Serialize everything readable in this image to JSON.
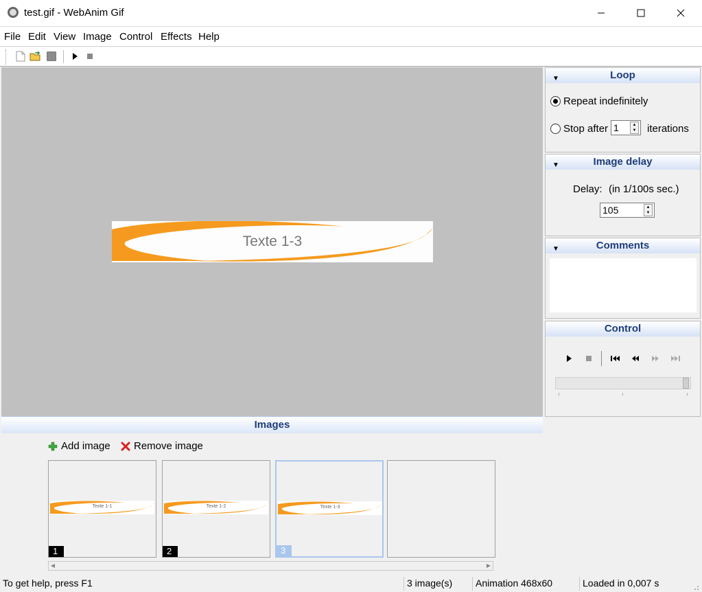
{
  "window": {
    "title": "test.gif - WebAnim Gif"
  },
  "menu": [
    "File",
    "Edit",
    "View",
    "Image",
    "Control",
    "Effects",
    "Help"
  ],
  "toolbar": {
    "icons": [
      "new-file-icon",
      "open-folder-icon",
      "save-icon",
      "play-icon",
      "stop-icon"
    ]
  },
  "canvas": {
    "banner_text": "Texte 1-3",
    "accent": "#f59a1e"
  },
  "images_panel": {
    "title": "Images",
    "add_label": "Add image",
    "remove_label": "Remove image",
    "thumbnails": [
      {
        "num": "1",
        "text": "Texte 1-1"
      },
      {
        "num": "2",
        "text": "Texte 1-2"
      },
      {
        "num": "3",
        "text": "Texte 1-3",
        "selected": true
      }
    ]
  },
  "loop": {
    "title": "Loop",
    "repeat_label": "Repeat indefinitely",
    "stop_label": "Stop after",
    "stop_value": "1",
    "iterations_label": "iterations"
  },
  "delay": {
    "title": "Image delay",
    "delay_label": "Delay:",
    "unit_label": "(in 1/100s sec.)",
    "value": "105"
  },
  "comments": {
    "title": "Comments"
  },
  "control": {
    "title": "Control"
  },
  "status": {
    "help": "To get help, press F1",
    "count": "3 image(s)",
    "animation": "Animation 468x60",
    "loaded": "Loaded in 0,007 s"
  }
}
